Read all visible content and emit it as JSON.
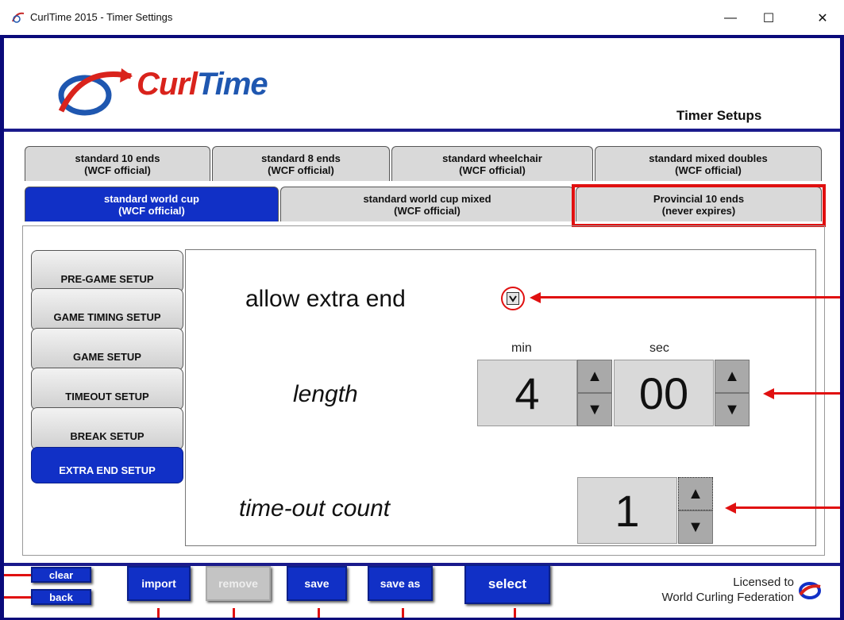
{
  "window": {
    "title": "CurlTime 2015 - Timer Settings",
    "controls": {
      "minimize": "—",
      "maximize": "☐",
      "close": "✕"
    }
  },
  "header": {
    "logo_text_a": "Curl",
    "logo_text_b": "Time",
    "page_heading": "Timer Setups"
  },
  "tabs_row1": [
    {
      "l1": "standard 10 ends",
      "l2": "(WCF official)"
    },
    {
      "l1": "standard 8 ends",
      "l2": "(WCF official)"
    },
    {
      "l1": "standard wheelchair",
      "l2": "(WCF official)"
    },
    {
      "l1": "standard mixed doubles",
      "l2": "(WCF official)"
    }
  ],
  "tabs_row2": [
    {
      "l1": "standard world cup",
      "l2": "(WCF official)"
    },
    {
      "l1": "standard world cup mixed",
      "l2": "(WCF official)"
    },
    {
      "l1": "Provincial 10 ends",
      "l2": "(never expires)"
    }
  ],
  "side_menu": [
    "PRE-GAME SETUP",
    "GAME TIMING SETUP",
    "GAME SETUP",
    "TIMEOUT SETUP",
    "BREAK SETUP",
    "EXTRA END SETUP"
  ],
  "settings": {
    "allow_extra_end_label": "allow extra end",
    "allow_extra_end_checked": true,
    "length_label": "length",
    "min_label": "min",
    "sec_label": "sec",
    "length_min": "4",
    "length_sec": "00",
    "timeout_label": "time-out count",
    "timeout_count": "1",
    "up_glyph": "▲",
    "down_glyph": "▼"
  },
  "buttons": {
    "clear": "clear",
    "back": "back",
    "import": "import",
    "remove": "remove",
    "save": "save",
    "save_as": "save as",
    "select": "select"
  },
  "license": {
    "line1": "Licensed to",
    "line2": "World Curling Federation"
  },
  "colors": {
    "accent_blue": "#1130c6",
    "frame_navy": "#0a0a7a",
    "annotation_red": "#e01010"
  }
}
